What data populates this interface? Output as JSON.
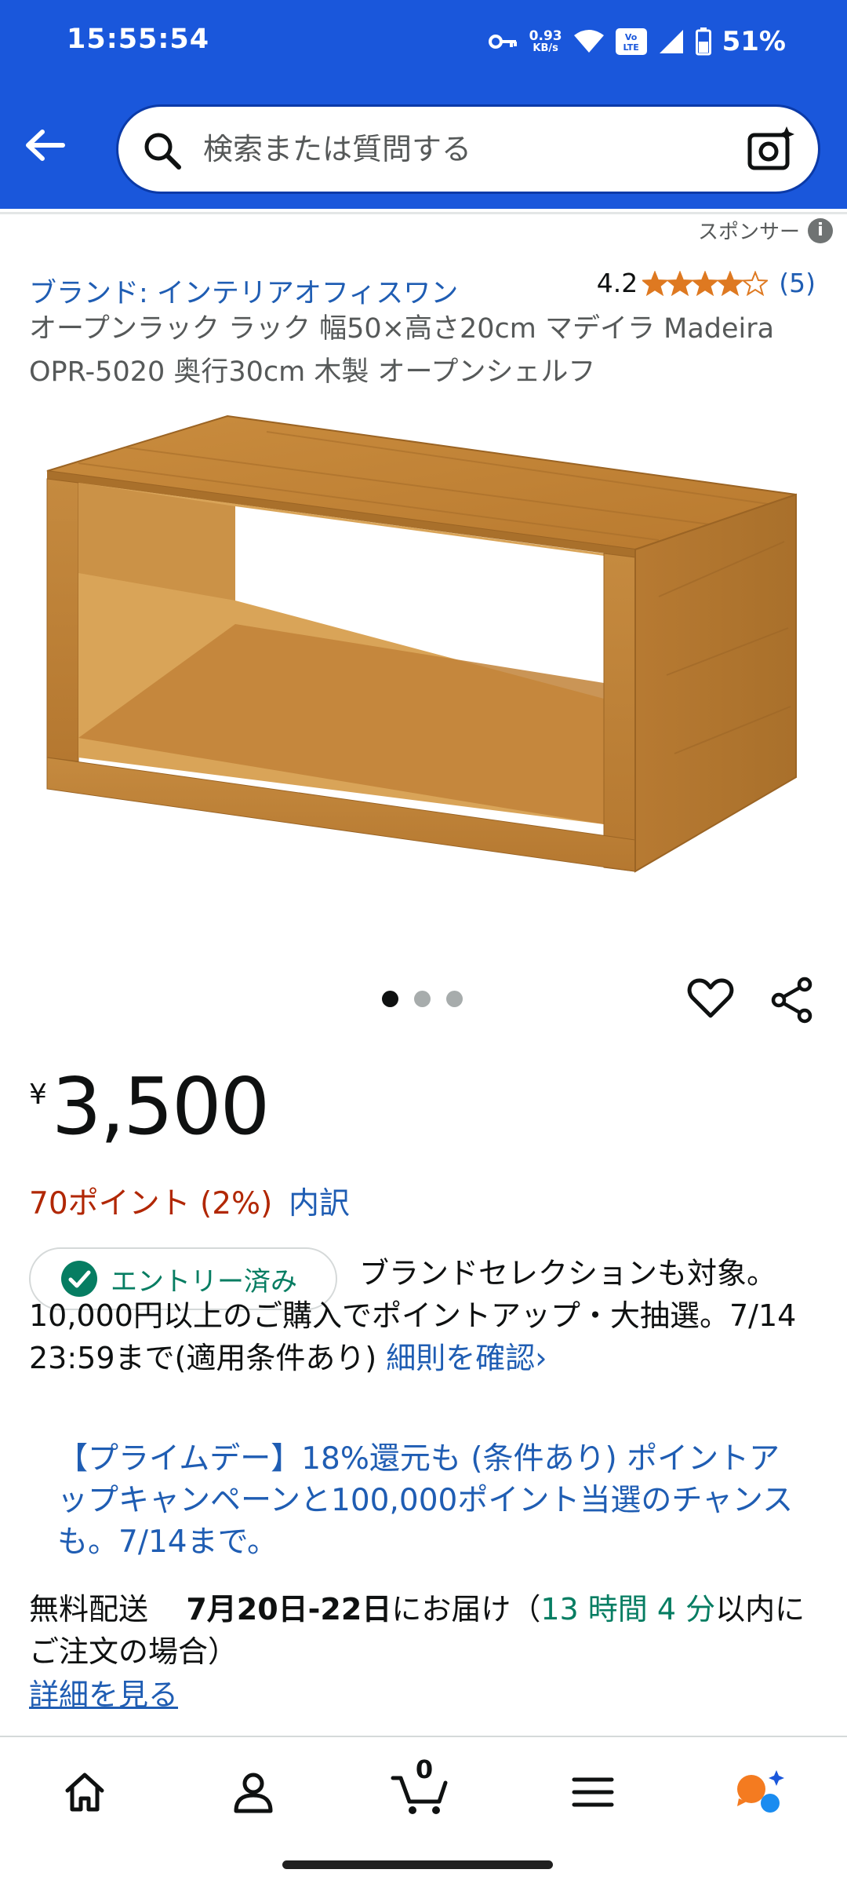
{
  "status_bar": {
    "time": "15:55:54",
    "net_speed_value": "0.93",
    "net_speed_unit": "KB/s",
    "volte_label": "Vo\nLTE",
    "battery": "51%"
  },
  "search": {
    "placeholder": "検索または質問する"
  },
  "sponsor_label": "スポンサー",
  "sponsor_info_glyph": "i",
  "product": {
    "brand": "ブランド: インテリアオフィスワン",
    "rating_value": "4.2",
    "rating_stars": 4.2,
    "rating_count": "(5)",
    "title": "オープンラック ラック 幅50×高さ20cm マデイラ Madeira OPR-5020 奥行30cm 木製 オープンシェルフ",
    "image_count": 3,
    "image_active_index": 0
  },
  "price": {
    "symbol": "¥",
    "value": "3,500"
  },
  "points": {
    "text": "70ポイント (2%)",
    "breakdown_link": "内訳"
  },
  "campaign": {
    "entry_label": "エントリー済み",
    "text": "ブランドセレクションも対象。10,000円以上のご購入でポイントアップ・大抽選。7/14 23:59まで(適用条件あり) ",
    "link": "細則を確認›"
  },
  "prime_day": {
    "text": "【プライムデー】18%還元も (条件あり) ポイントアップキャンペーンと100,000ポイント当選のチャンスも。7/14まで。"
  },
  "delivery": {
    "free_label": "無料配送",
    "date": "7月20日-22日",
    "deliver_text": "にお届け（",
    "countdown": "13 時間 4 分",
    "order_text": "以内にご注文の場合）",
    "details_link": "詳細を見る"
  },
  "bottom_nav": {
    "cart_count": "0"
  },
  "colors": {
    "header": "#1a57db",
    "link": "#1f5db3",
    "price_points": "#b12704",
    "success": "#067d62",
    "star": "#de7921"
  }
}
